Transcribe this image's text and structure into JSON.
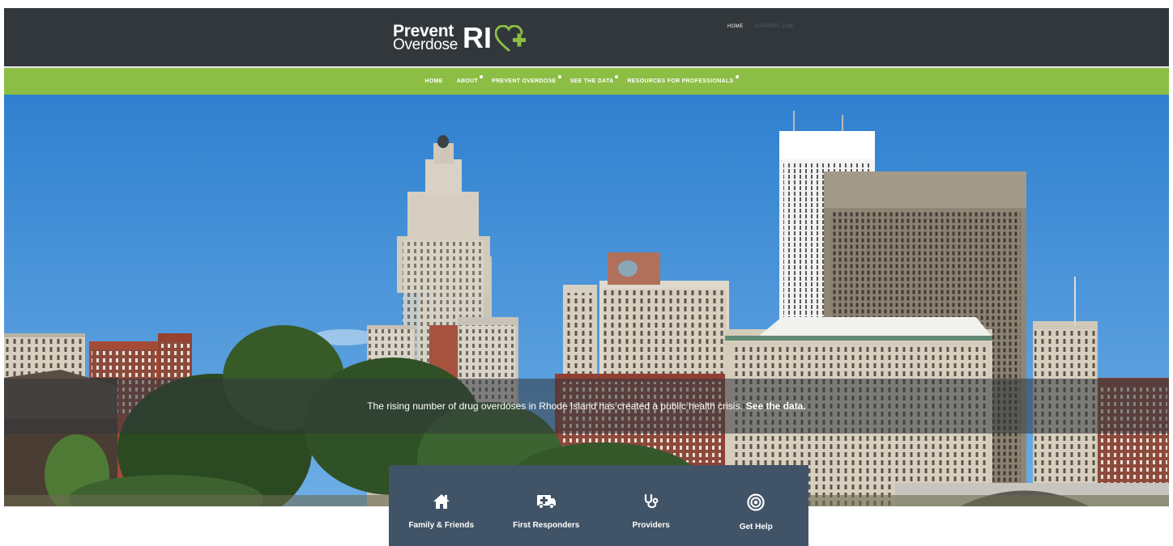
{
  "header": {
    "logo": {
      "line1": "Prevent",
      "line2": "Overdose",
      "state": "RI"
    },
    "utility_nav": [
      {
        "label": "HOME"
      },
      {
        "label": "SUPPORT LINE"
      }
    ]
  },
  "main_nav": {
    "items": [
      {
        "label": "HOME",
        "has_submenu": false
      },
      {
        "label": "ABOUT",
        "has_submenu": true
      },
      {
        "label": "PREVENT OVERDOSE",
        "has_submenu": true
      },
      {
        "label": "SEE THE DATA",
        "has_submenu": true
      },
      {
        "label": "RESOURCES FOR PROFESSIONALS",
        "has_submenu": true
      }
    ]
  },
  "hero": {
    "message": "The rising number of drug overdoses in Rhode Island has created a public health crisis.",
    "link": "See the data."
  },
  "audience": [
    {
      "label": "Family & Friends",
      "icon": "home-icon"
    },
    {
      "label": "First Responders",
      "icon": "ambulance-icon"
    },
    {
      "label": "Providers",
      "icon": "stethoscope-icon"
    },
    {
      "label": "Get Help",
      "icon": "target-icon"
    }
  ],
  "colors": {
    "header_bg": "#31373b",
    "nav_green": "#8cbd45",
    "panel_bg": "#415366",
    "logo_heart": "#8cbd45",
    "sky": "#3f8fd8"
  }
}
